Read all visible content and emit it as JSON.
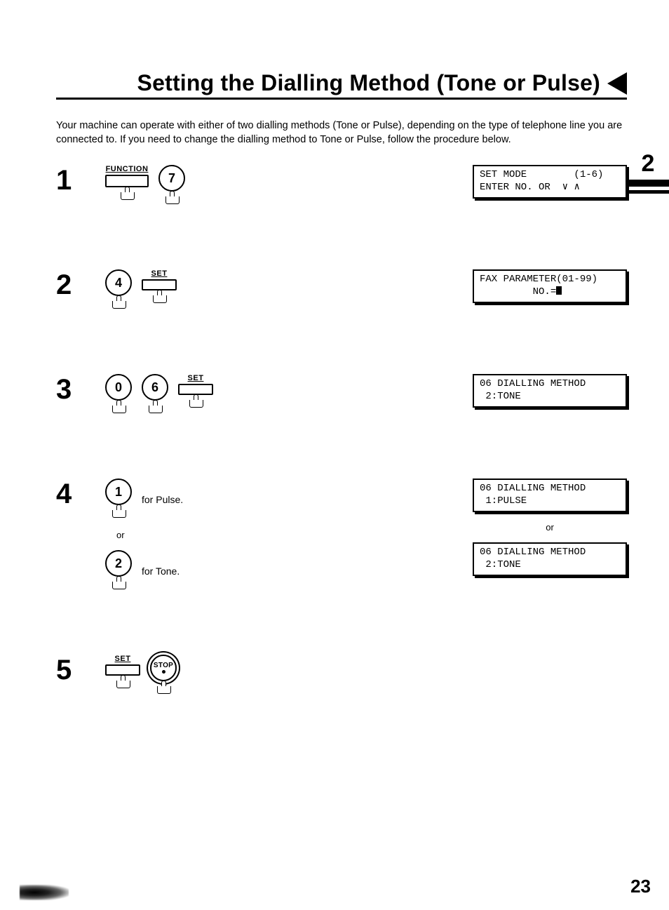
{
  "title": "Setting the Dialling Method (Tone or Pulse)",
  "intro": "Your machine can operate with either of two dialling methods (Tone or Pulse), depending on the type of telephone line you are connected to.  If you need to change the dialling method to Tone or Pulse, follow the procedure below.",
  "side_tab": "2",
  "page_number": "23",
  "labels": {
    "function": "FUNCTION",
    "set": "SET",
    "stop": "STOP",
    "or": "or",
    "for_pulse": "for Pulse.",
    "for_tone": "for Tone."
  },
  "keys": {
    "seven": "7",
    "four": "4",
    "zero": "0",
    "six": "6",
    "one": "1",
    "two": "2"
  },
  "steps": {
    "s1": "1",
    "s2": "2",
    "s3": "3",
    "s4": "4",
    "s5": "5"
  },
  "lcd": {
    "s1_line1": "SET MODE        (1-6)",
    "s1_line2": "ENTER NO. OR  ∨ ∧",
    "s2_line1": "FAX PARAMETER(01-99)",
    "s2_line2_prefix": "         NO.=",
    "s3_line1": "06 DIALLING METHOD",
    "s3_line2": " 2:TONE",
    "s4a_line1": "06 DIALLING METHOD",
    "s4a_line2": " 1:PULSE",
    "s4b_line1": "06 DIALLING METHOD",
    "s4b_line2": " 2:TONE"
  }
}
